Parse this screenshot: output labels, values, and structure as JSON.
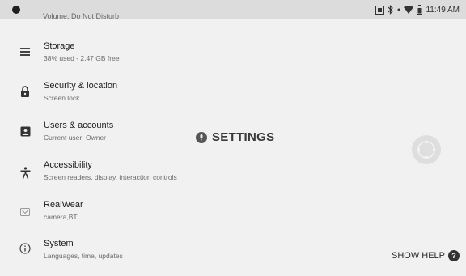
{
  "status_bar": {
    "time": "11:49 AM",
    "icons": [
      "notification-dot",
      "nfc-icon",
      "bluetooth-icon",
      "wifi-icon",
      "battery-icon"
    ]
  },
  "clipped_summary": "Volume, Do Not Disturb",
  "settings_items": [
    {
      "icon": "storage-icon",
      "title": "Storage",
      "summary": "38% used - 2.47 GB free"
    },
    {
      "icon": "lock-icon",
      "title": "Security & location",
      "summary": "Screen lock"
    },
    {
      "icon": "account-icon",
      "title": "Users & accounts",
      "summary": "Current user: Owner"
    },
    {
      "icon": "accessibility-icon",
      "title": "Accessibility",
      "summary": "Screen readers, display, interaction controls"
    },
    {
      "icon": "realwear-icon",
      "title": "RealWear",
      "summary": "camera,BT"
    },
    {
      "icon": "info-icon",
      "title": "System",
      "summary": "Languages, time, updates"
    }
  ],
  "overlay": {
    "label": "SETTINGS"
  },
  "help": {
    "label": "SHOW HELP",
    "badge": "?"
  },
  "colors": {
    "background": "#f1f1f1",
    "status_bar": "#dcdcdc",
    "text": "#222222"
  }
}
